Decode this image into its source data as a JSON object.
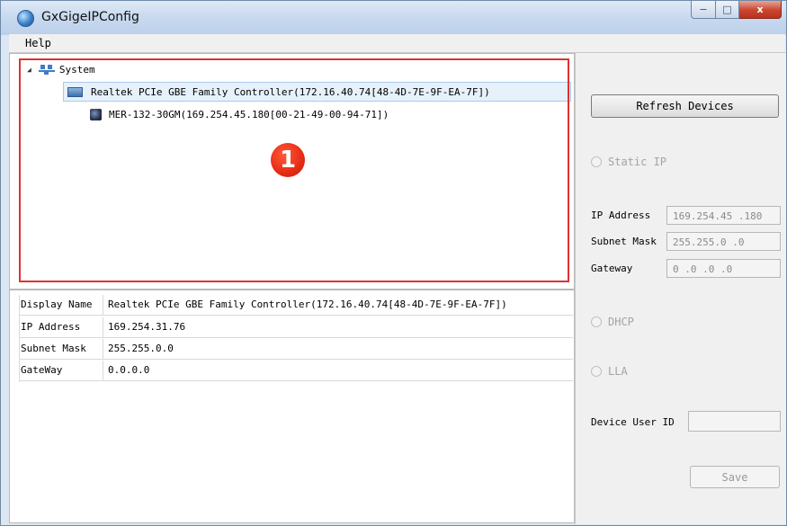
{
  "window": {
    "title": "GxGigeIPConfig",
    "caption_min": "−",
    "caption_max": "□",
    "caption_close": "x"
  },
  "menu": {
    "help": "Help"
  },
  "tree": {
    "root_label": "System",
    "controller_label": "Realtek PCIe GBE Family Controller(172.16.40.74[48-4D-7E-9F-EA-7F])",
    "camera_label": "MER-132-30GM(169.254.45.180[00-21-49-00-94-71])",
    "callout_number": "1"
  },
  "properties": [
    {
      "label": "Display Name",
      "value": "Realtek PCIe GBE Family Controller(172.16.40.74[48-4D-7E-9F-EA-7F])"
    },
    {
      "label": "IP Address",
      "value": "169.254.31.76"
    },
    {
      "label": "Subnet Mask",
      "value": "255.255.0.0"
    },
    {
      "label": "GateWay",
      "value": "0.0.0.0"
    }
  ],
  "right_panel": {
    "refresh_button": "Refresh Devices",
    "static_ip_label": "Static IP",
    "ip_address_label": "IP Address",
    "ip_address_value": "169.254.45 .180",
    "subnet_mask_label": "Subnet Mask",
    "subnet_mask_value": "255.255.0  .0",
    "gateway_label": "Gateway",
    "gateway_value": "0  .0  .0  .0",
    "dhcp_label": "DHCP",
    "lla_label": "LLA",
    "device_user_id_label": "Device User ID",
    "device_user_id_value": "",
    "save_button": "Save"
  },
  "colors": {
    "highlight_border": "#e03030",
    "callout": "#e62b14",
    "selection": "#e7f1fb"
  }
}
